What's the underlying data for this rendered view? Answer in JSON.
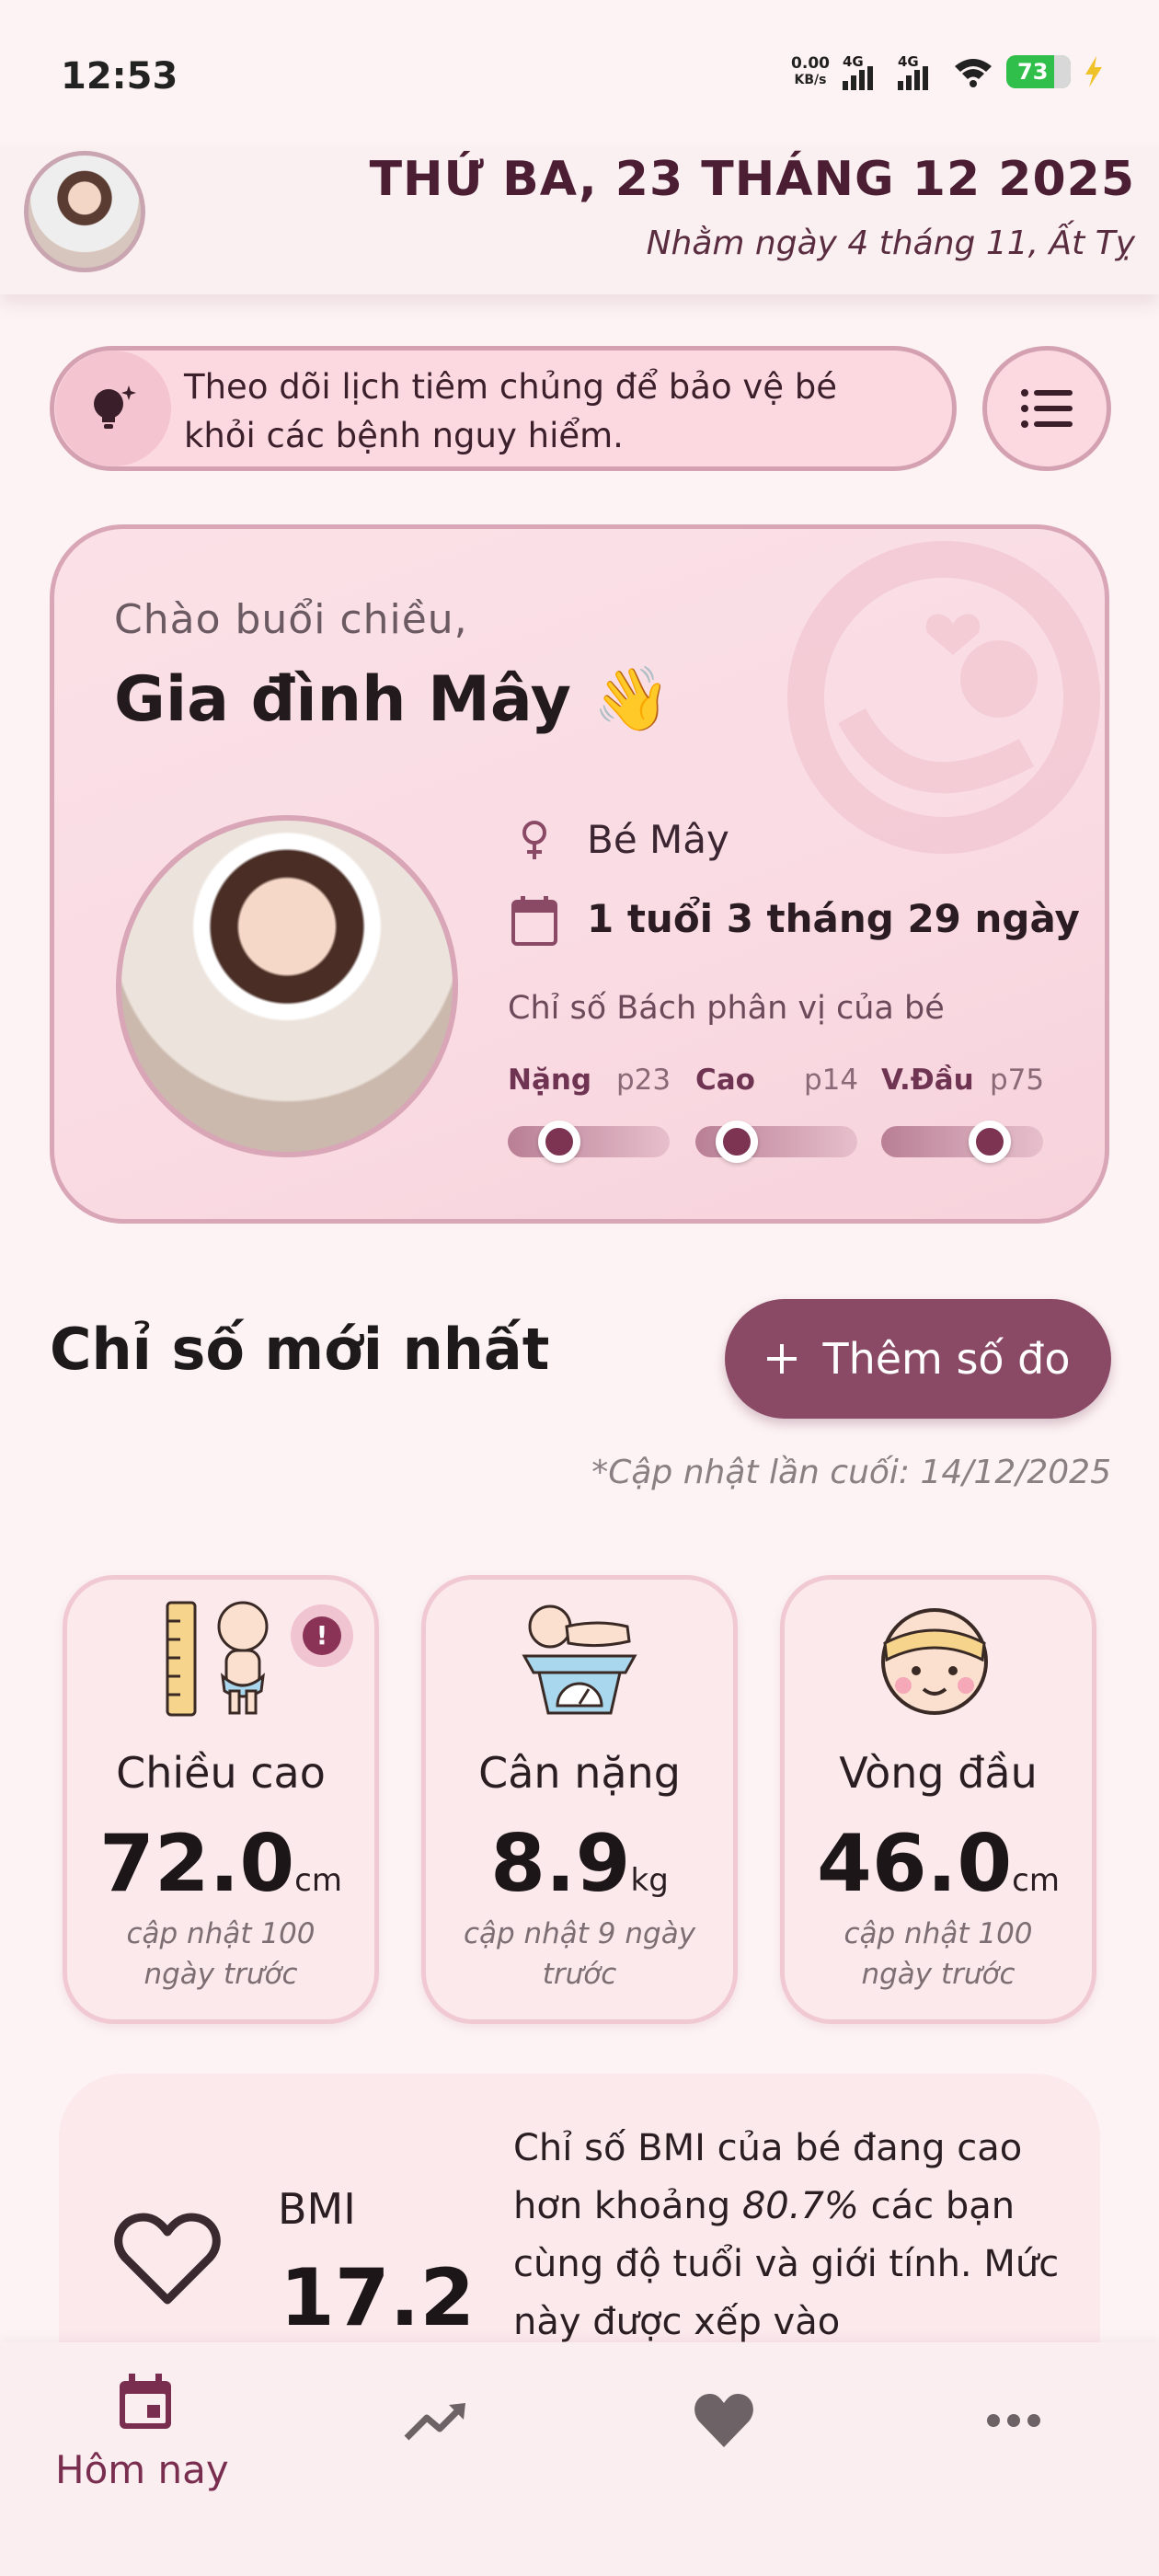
{
  "status": {
    "time": "12:53",
    "net_speed_top": "0.00",
    "net_speed_bottom": "KB/s",
    "sim1": "4G",
    "sim2": "4G",
    "battery": "73"
  },
  "header": {
    "date": "THỨ BA, 23 THÁNG 12 2025",
    "lunar": "Nhằm ngày 4 tháng 11, Ất Tỵ"
  },
  "tip": {
    "text": "Theo dõi lịch tiêm chủng để bảo vệ bé khỏi các bệnh nguy hiểm."
  },
  "hero": {
    "greeting": "Chào buổi chiều,",
    "family": "Gia đình Mây 👋",
    "baby_name": "Bé Mây",
    "age": "1 tuổi 3 tháng 29 ngày",
    "percentile_title": "Chỉ số Bách phân vị của bé",
    "percentiles": [
      {
        "label": "Nặng",
        "value": "p23",
        "fraction": 0.23
      },
      {
        "label": "Cao",
        "value": "p14",
        "fraction": 0.14
      },
      {
        "label": "V.Đầu",
        "value": "p75",
        "fraction": 0.75
      }
    ]
  },
  "latest": {
    "title": "Chỉ số mới nhất",
    "add_button": "Thêm số đo",
    "updated": "*Cập nhật lần cuối: 14/12/2025",
    "cards": [
      {
        "title": "Chiều cao",
        "value": "72.0",
        "unit": "cm",
        "note": "cập nhật 100 ngày trước"
      },
      {
        "title": "Cân nặng",
        "value": "8.9",
        "unit": "kg",
        "note": "cập nhật 9 ngày trước"
      },
      {
        "title": "Vòng đầu",
        "value": "46.0",
        "unit": "cm",
        "note": "cập nhật 100 ngày trước"
      }
    ]
  },
  "bmi": {
    "label": "BMI",
    "value": "17.2",
    "text_before": "Chỉ số BMI của bé đang cao hơn khoảng ",
    "text_pct": "80.7%",
    "text_after": " các bạn cùng độ tuổi và giới tính. Mức này được xếp vào"
  },
  "nav": {
    "today": "Hôm nay"
  },
  "colors": {
    "accent": "#8a4a65",
    "card_bg": "#fce9ec",
    "header_text": "#4b1e33"
  }
}
